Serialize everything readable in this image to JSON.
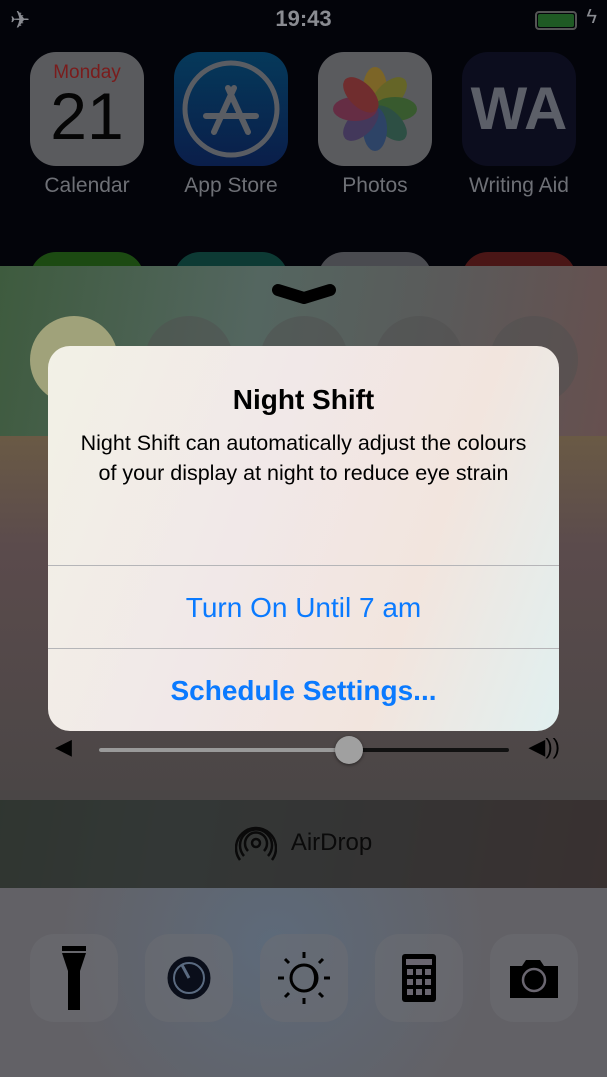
{
  "status": {
    "time": "19:43",
    "airplane_icon": "airplane-icon",
    "battery_icon": "battery-charging-icon"
  },
  "apps": [
    {
      "label": "Calendar",
      "day": "Monday",
      "date": "21"
    },
    {
      "label": "App Store"
    },
    {
      "label": "Photos"
    },
    {
      "label": "Writing Aid",
      "glyph": "WA"
    }
  ],
  "volume": {
    "level": 0.61
  },
  "airdrop": {
    "label": "AirDrop"
  },
  "tools": [
    "flashlight-icon",
    "timer-icon",
    "night-shift-icon",
    "calculator-icon",
    "camera-icon"
  ],
  "alert": {
    "title": "Night Shift",
    "message": "Night Shift can automatically adjust the colours of your display at night to reduce eye strain",
    "primary": "Turn On Until 7 am",
    "secondary": "Schedule Settings..."
  },
  "colors": {
    "accent": "#0a7aff"
  }
}
